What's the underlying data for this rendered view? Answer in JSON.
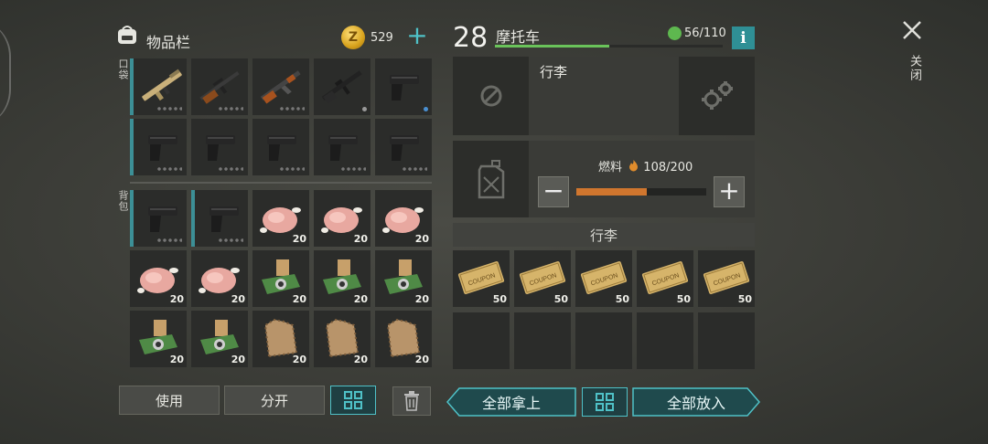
{
  "inventory": {
    "title": "物品栏",
    "coins": "529",
    "pocket_label": "口袋",
    "backpack_label": "背包",
    "pocket_slots": [
      {
        "item": "scar-rifle-icon",
        "marker": "dots"
      },
      {
        "item": "svd-rifle-icon",
        "marker": "dots"
      },
      {
        "item": "ak47-rifle-icon",
        "marker": "dots"
      },
      {
        "item": "m4-rifle-icon",
        "marker": "dot-grey"
      },
      {
        "item": "pistol-icon",
        "marker": "dot-blue"
      },
      {
        "item": "pistol-icon",
        "marker": "dots"
      },
      {
        "item": "pistol-icon",
        "marker": "dots"
      },
      {
        "item": "pistol-icon",
        "marker": "dots"
      },
      {
        "item": "pistol-icon",
        "marker": "dots"
      },
      {
        "item": "pistol-icon",
        "marker": "dots"
      }
    ],
    "backpack_slots": [
      {
        "item": "pistol-icon",
        "marker": "dots",
        "qty": ""
      },
      {
        "item": "pistol-icon",
        "marker": "dots",
        "qty": ""
      },
      {
        "item": "raw-chicken-icon",
        "qty": "20"
      },
      {
        "item": "raw-chicken-icon",
        "qty": "20"
      },
      {
        "item": "raw-chicken-icon",
        "qty": "20"
      },
      {
        "item": "raw-chicken-icon",
        "qty": "20"
      },
      {
        "item": "raw-chicken-icon",
        "qty": "20"
      },
      {
        "item": "circuit-board-icon",
        "qty": "20"
      },
      {
        "item": "circuit-board-icon",
        "qty": "20"
      },
      {
        "item": "circuit-board-icon",
        "qty": "20"
      },
      {
        "item": "circuit-board-icon",
        "qty": "20"
      },
      {
        "item": "circuit-board-icon",
        "qty": "20"
      },
      {
        "item": "animal-fur-icon",
        "qty": "20"
      },
      {
        "item": "animal-fur-icon",
        "qty": "20"
      },
      {
        "item": "animal-fur-icon",
        "qty": "20"
      }
    ],
    "use_label": "使用",
    "split_label": "分开"
  },
  "vehicle": {
    "level": "28",
    "name": "摩托车",
    "xp_fraction": 0.5,
    "capacity": "56/110",
    "info_label": "i",
    "cargo_label": "行李",
    "fuel_label": "燃料",
    "fuel_value": "108/200",
    "fuel_fraction": 0.54,
    "minus_label": "−",
    "plus_label": "+",
    "section_label": "行李",
    "cargo_slots": [
      {
        "item": "coupon-icon",
        "text": "COUPON",
        "qty": "50"
      },
      {
        "item": "coupon-icon",
        "text": "COUPON",
        "qty": "50"
      },
      {
        "item": "coupon-icon",
        "text": "COUPON",
        "qty": "50"
      },
      {
        "item": "coupon-icon",
        "text": "COUPON",
        "qty": "50"
      },
      {
        "item": "coupon-icon",
        "text": "COUPON",
        "qty": "50"
      },
      {
        "item": "",
        "qty": ""
      },
      {
        "item": "",
        "qty": ""
      },
      {
        "item": "",
        "qty": ""
      },
      {
        "item": "",
        "qty": ""
      },
      {
        "item": "",
        "qty": ""
      }
    ],
    "take_all_label": "全部拿上",
    "put_all_label": "全部放入"
  },
  "close_label": "关闭",
  "colors": {
    "accent": "#4fc1c7",
    "xp": "#6ac35a",
    "fuel": "#d0762e",
    "coin": "#d7a21c"
  }
}
